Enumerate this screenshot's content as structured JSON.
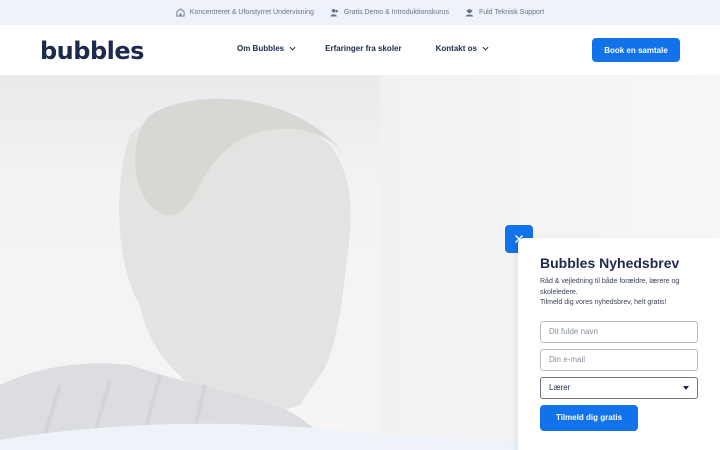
{
  "topbar": {
    "items": [
      {
        "icon": "school-icon",
        "label": "Koncentreret & Uforstyrret Undervisning"
      },
      {
        "icon": "users-icon",
        "label": "Gratis Demo & Introduktionskurus"
      },
      {
        "icon": "support-icon",
        "label": "Fuld Teknisk Support"
      }
    ]
  },
  "header": {
    "logo_text": "bubbles",
    "nav": [
      {
        "label": "Om Bubbles",
        "has_dropdown": true
      },
      {
        "label": "Erfaringer fra skoler",
        "has_dropdown": false
      },
      {
        "label": "Kontakt os",
        "has_dropdown": true
      }
    ],
    "cta_label": "Book en samtale"
  },
  "popup": {
    "title": "Bubbles Nyhedsbrev",
    "description_line1": "Råd & vejledning til både forældre, lærere og skoleledere.",
    "description_line2": "Tilmeld dig vores nyhedsbrev, helt gratis!",
    "name_placeholder": "Dit fulde navn",
    "email_placeholder": "Din e-mail",
    "role_selected": "Lærer",
    "submit_label": "Tilmeld dig gratis"
  },
  "colors": {
    "accent": "#1272ea",
    "brand_dark": "#1b2a4e",
    "topbar_bg": "#eef3fb"
  }
}
